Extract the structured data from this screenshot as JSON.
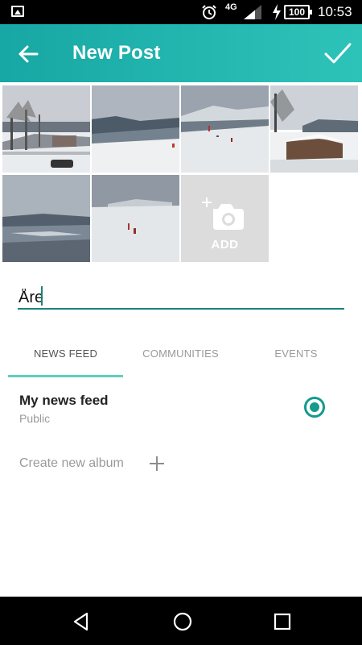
{
  "status_bar": {
    "network": "4G",
    "battery": "100",
    "time": "10:53"
  },
  "app_bar": {
    "title": "New Post",
    "back_icon": "arrow-left-icon",
    "confirm_icon": "checkmark-icon"
  },
  "photos": {
    "count": 6,
    "add_label": "ADD",
    "add_icon": "add-photo-camera-icon"
  },
  "title_field": {
    "value": "Åre"
  },
  "tabs": [
    {
      "label": "NEWS FEED",
      "selected": true
    },
    {
      "label": "COMMUNITIES",
      "selected": false
    },
    {
      "label": "EVENTS",
      "selected": false
    }
  ],
  "feed": {
    "title": "My news feed",
    "visibility": "Public",
    "selected": true
  },
  "album": {
    "create_label": "Create new album",
    "icon": "plus-icon"
  },
  "colors": {
    "accent": "#17a7a4",
    "accent_dark": "#159b8e",
    "tab_indicator": "#5fcfbe"
  }
}
